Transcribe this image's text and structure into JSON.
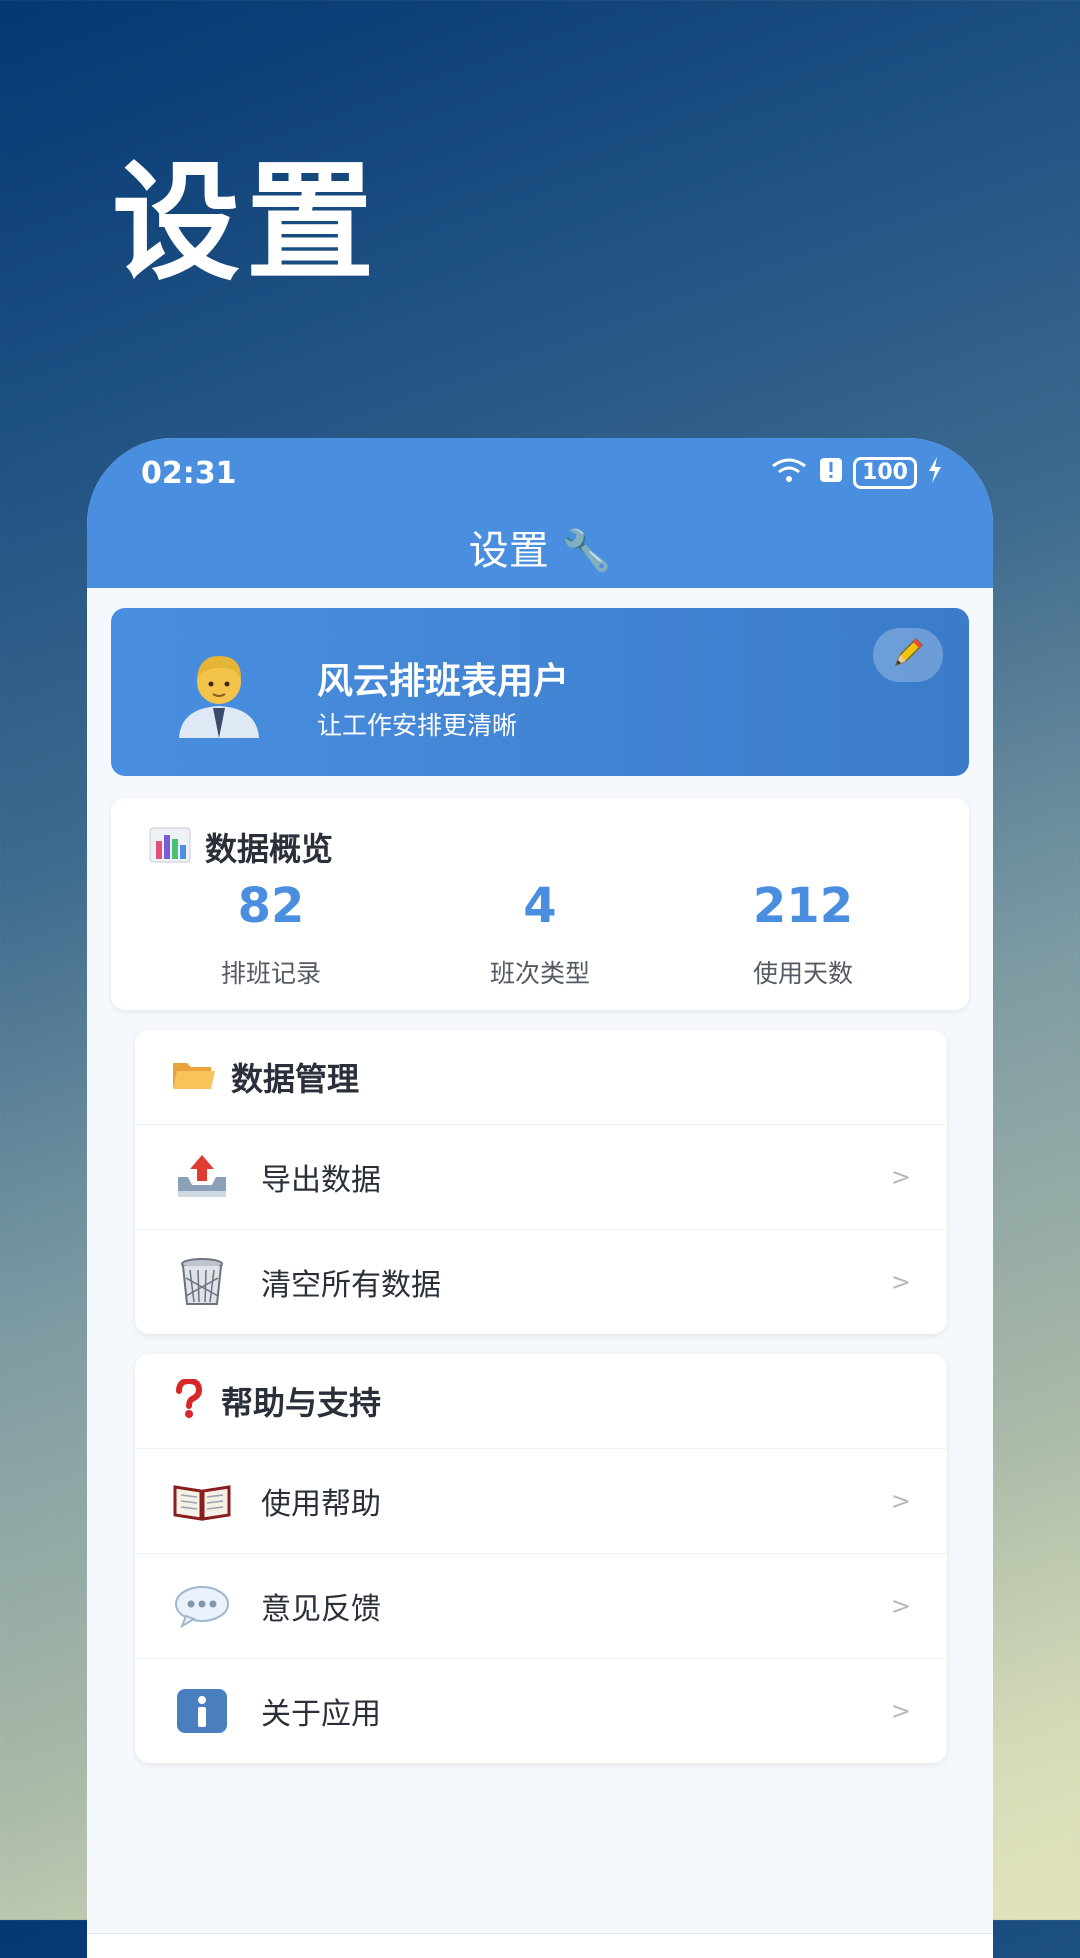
{
  "hero": {
    "title": "设置"
  },
  "status_bar": {
    "time": "02:31",
    "battery": "100"
  },
  "appbar": {
    "title": "设置 🔧"
  },
  "profile": {
    "name": "风云排班表用户",
    "subtitle": "让工作安排更清晰",
    "avatar_icon": "man-office-worker-icon",
    "edit_icon": "pencil-icon"
  },
  "overview": {
    "title": "数据概览",
    "icon": "bar-chart-icon",
    "stats": [
      {
        "value": "82",
        "label": "排班记录"
      },
      {
        "value": "4",
        "label": "班次类型"
      },
      {
        "value": "212",
        "label": "使用天数"
      }
    ]
  },
  "data_management": {
    "title": "数据管理",
    "icon": "folder-icon",
    "items": [
      {
        "label": "导出数据",
        "icon": "export-tray-icon",
        "chevron": ">"
      },
      {
        "label": "清空所有数据",
        "icon": "trash-icon",
        "chevron": ">"
      }
    ]
  },
  "help_support": {
    "title": "帮助与支持",
    "icon": "question-icon",
    "items": [
      {
        "label": "使用帮助",
        "icon": "book-icon",
        "chevron": ">"
      },
      {
        "label": "意见反馈",
        "icon": "speech-bubble-icon",
        "chevron": ">"
      },
      {
        "label": "关于应用",
        "icon": "info-icon",
        "chevron": ">"
      }
    ]
  },
  "colors": {
    "accent": "#4a8ee0",
    "text": "#2a2f3a"
  }
}
